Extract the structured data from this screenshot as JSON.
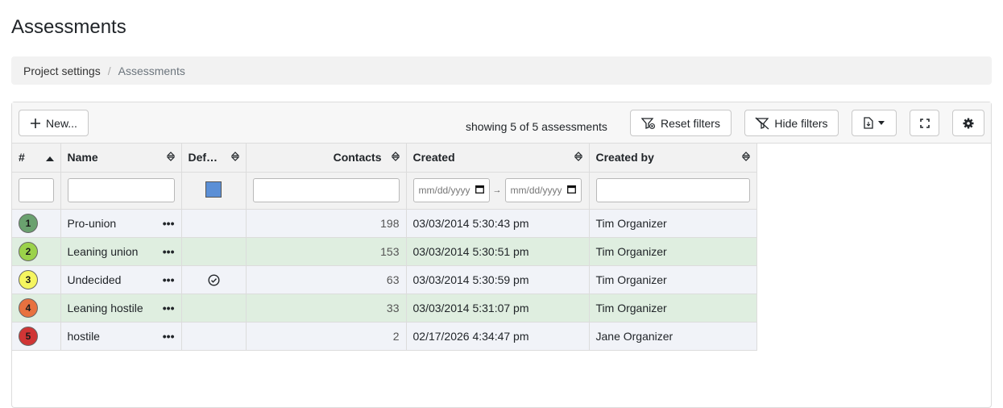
{
  "page": {
    "title": "Assessments"
  },
  "breadcrumb": {
    "items": [
      "Project settings",
      "Assessments"
    ]
  },
  "toolbar": {
    "new_label": "New...",
    "showing_text": "showing 5 of 5 assessments",
    "reset_filters_label": "Reset filters",
    "hide_filters_label": "Hide filters"
  },
  "table": {
    "columns": [
      "#",
      "Name",
      "Def…",
      "Contacts",
      "Created",
      "Created by"
    ],
    "date_placeholder": "mm/dd/yyyy",
    "default_filter_color": "#5b8fd6",
    "rows": [
      {
        "num": "1",
        "color": "#6aa16f",
        "name": "Pro-union",
        "default": false,
        "contacts": "198",
        "created": "03/03/2014 5:30:43 pm",
        "created_by": "Tim Organizer"
      },
      {
        "num": "2",
        "color": "#9bd24a",
        "name": "Leaning union",
        "default": false,
        "contacts": "153",
        "created": "03/03/2014 5:30:51 pm",
        "created_by": "Tim Organizer"
      },
      {
        "num": "3",
        "color": "#f5f560",
        "name": "Undecided",
        "default": true,
        "contacts": "63",
        "created": "03/03/2014 5:30:59 pm",
        "created_by": "Tim Organizer"
      },
      {
        "num": "4",
        "color": "#e8713f",
        "name": "Leaning hostile",
        "default": false,
        "contacts": "33",
        "created": "03/03/2014 5:31:07 pm",
        "created_by": "Tim Organizer"
      },
      {
        "num": "5",
        "color": "#d03535",
        "name": "hostile",
        "default": false,
        "contacts": "2",
        "created": "02/17/2026 4:34:47 pm",
        "created_by": "Jane Organizer"
      }
    ]
  }
}
